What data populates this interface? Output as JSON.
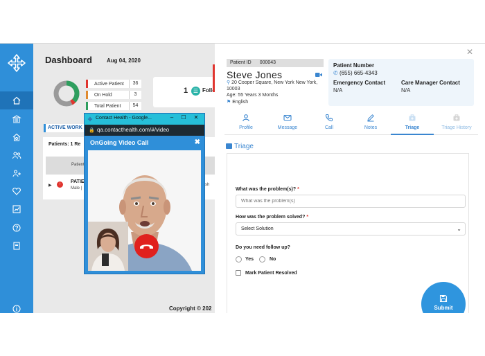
{
  "dashboard": {
    "title": "Dashboard",
    "date": "Aug 04, 2020",
    "stats": [
      {
        "label": "Active Patient",
        "value": "36"
      },
      {
        "label": "On Hold",
        "value": "3"
      },
      {
        "label": "Total Patient",
        "value": "54"
      }
    ],
    "follow_count": "1",
    "follow_label": "Follo",
    "active_work_label": "ACTIVE WORK",
    "patients_line": "Patients: 1     Re",
    "table_header": "Patient",
    "row_name": "PATIE",
    "row_sub": "Male |",
    "row_extra": "glish",
    "copyright": "Copyright © 202"
  },
  "popup": {
    "window_title": "Contact Health - Google...",
    "url": "qa.contacthealth.com/#/video",
    "heading": "OnGoing Video Call",
    "close_label": "✖"
  },
  "patient": {
    "id_label": "Patient ID",
    "id_value": "000043",
    "name": "Steve  Jones",
    "address": "20 Cooper Square, New York New York, 10003",
    "age": "Age: 55 Years 3 Months",
    "language": "English",
    "phone_label": "Patient Number",
    "phone": "(655) 665-4343",
    "emergency_label": "Emergency Contact",
    "emergency_value": "N/A",
    "care_label": "Care Manager Contact",
    "care_value": "N/A"
  },
  "tabs": [
    {
      "label": "Profile",
      "icon": "user-icon"
    },
    {
      "label": "Message",
      "icon": "mail-icon"
    },
    {
      "label": "Call",
      "icon": "phone-icon"
    },
    {
      "label": "Notes",
      "icon": "edit-icon"
    },
    {
      "label": "Triage",
      "icon": "briefcase-icon"
    },
    {
      "label": "Triage History",
      "icon": "briefcase-icon"
    }
  ],
  "triage": {
    "title": "Triage",
    "q1_label": "What was the problem(s)?",
    "q1_placeholder": "What was the problem(s)",
    "q2_label": "How was the problem solved?",
    "q2_value": "Select Solution",
    "q3_label": "Do you need follow up?",
    "yes": "Yes",
    "no": "No",
    "resolved_label": "Mark Patient Resolved",
    "submit": "Submit"
  },
  "colors": {
    "sidebar": "#2f8fd9",
    "accent": "#3a86d0",
    "danger": "#e0352f"
  }
}
